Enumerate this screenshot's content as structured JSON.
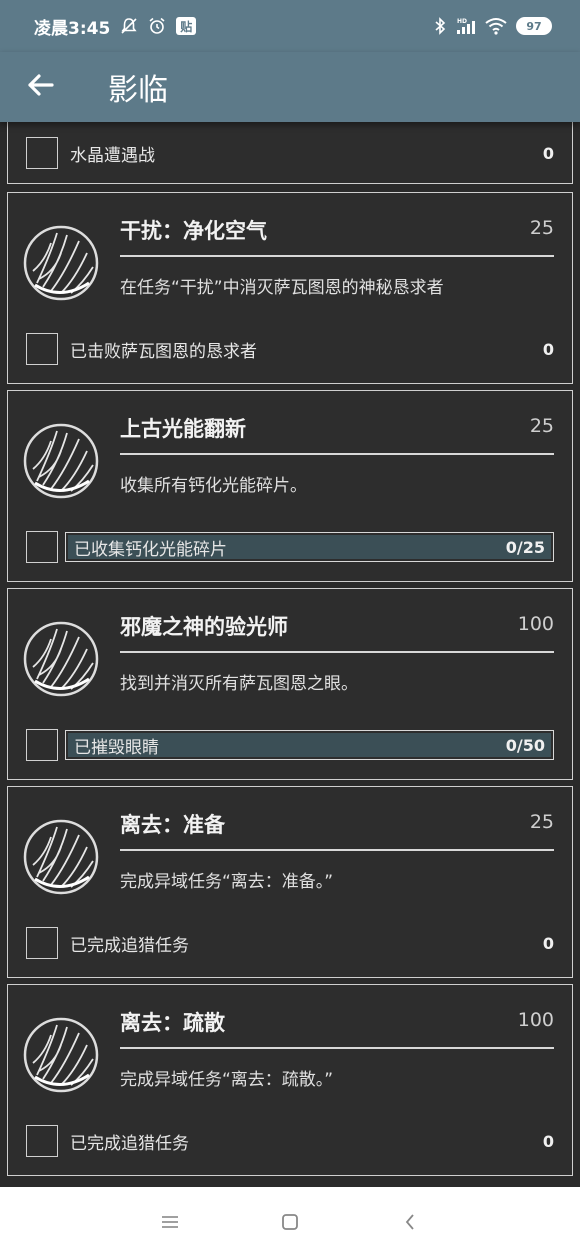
{
  "status_bar": {
    "time": "凌晨3:45",
    "sticker_label": "贴",
    "battery": "97",
    "hd_label": "HD"
  },
  "app_bar": {
    "title": "影临"
  },
  "partial_card": {
    "objective_label": "水晶遭遇战",
    "objective_value": "0"
  },
  "cards": [
    {
      "title": "干扰：净化空气",
      "score": "25",
      "description": "在任务“干扰”中消灭萨瓦图恩的神秘恳求者",
      "objective_label": "已击败萨瓦图恩的恳求者",
      "objective_value": "0",
      "progress_fraction": null
    },
    {
      "title": "上古光能翻新",
      "score": "25",
      "description": "收集所有钙化光能碎片。",
      "objective_label": "已收集钙化光能碎片",
      "objective_value": "0/25",
      "progress_fraction": 0
    },
    {
      "title": "邪魔之神的验光师",
      "score": "100",
      "description": "找到并消灭所有萨瓦图恩之眼。",
      "objective_label": "已摧毁眼睛",
      "objective_value": "0/50",
      "progress_fraction": 0
    },
    {
      "title": "离去：准备",
      "score": "25",
      "description": "完成异域任务“离去：准备。”",
      "objective_label": "已完成追猎任务",
      "objective_value": "0",
      "progress_fraction": null
    },
    {
      "title": "离去：疏散",
      "score": "100",
      "description": "完成异域任务“离去：疏散。”",
      "objective_label": "已完成追猎任务",
      "objective_value": "0",
      "progress_fraction": null
    }
  ],
  "colors": {
    "app_bar": "#5d7a89",
    "background": "#2a2a2a",
    "progress_fill": "#3b4f56",
    "nav_bar": "#ffffff"
  }
}
